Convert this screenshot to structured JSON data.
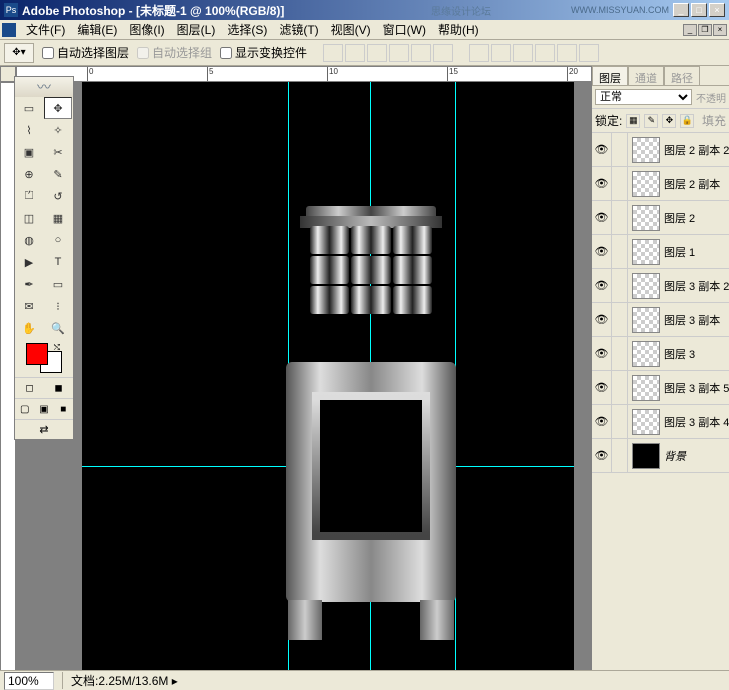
{
  "titlebar": {
    "app": "Adobe Photoshop",
    "doc": "[未标题-1 @ 100%(RGB/8)]",
    "watermark": "思缘设计论坛",
    "url": "WWW.MISSYUAN.COM"
  },
  "menu": {
    "file": "文件(F)",
    "edit": "编辑(E)",
    "image": "图像(I)",
    "layer": "图层(L)",
    "select": "选择(S)",
    "filter": "滤镜(T)",
    "view": "视图(V)",
    "window": "窗口(W)",
    "help": "帮助(H)"
  },
  "options": {
    "auto_select_layer": "自动选择图层",
    "auto_select_group": "自动选择组",
    "show_transform": "显示变换控件"
  },
  "ruler": {
    "ticks": [
      "0",
      "5",
      "10",
      "15",
      "20"
    ]
  },
  "panels": {
    "tabs": {
      "layers": "图层",
      "channels": "通道",
      "paths": "路径"
    },
    "blend": "正常",
    "opacity_lbl": "不透明",
    "lock_lbl": "锁定:",
    "fill_lbl": "填充",
    "layers": [
      {
        "name": "图层 2 副本 2",
        "thumb": "trans"
      },
      {
        "name": "图层 2 副本",
        "thumb": "trans"
      },
      {
        "name": "图层 2",
        "thumb": "trans"
      },
      {
        "name": "图层 1",
        "thumb": "trans"
      },
      {
        "name": "图层 3 副本 2",
        "thumb": "trans"
      },
      {
        "name": "图层 3 副本",
        "thumb": "trans"
      },
      {
        "name": "图层 3",
        "thumb": "trans"
      },
      {
        "name": "图层 3 副本 5",
        "thumb": "trans"
      },
      {
        "name": "图层 3 副本 4",
        "thumb": "trans"
      },
      {
        "name": "背景",
        "thumb": "black",
        "italic": true
      }
    ]
  },
  "status": {
    "zoom": "100%",
    "doc_label": "文档:",
    "doc_size": "2.25M/13.6M"
  },
  "colors": {
    "fg": "#ff0000",
    "bg": "#ffffff"
  }
}
